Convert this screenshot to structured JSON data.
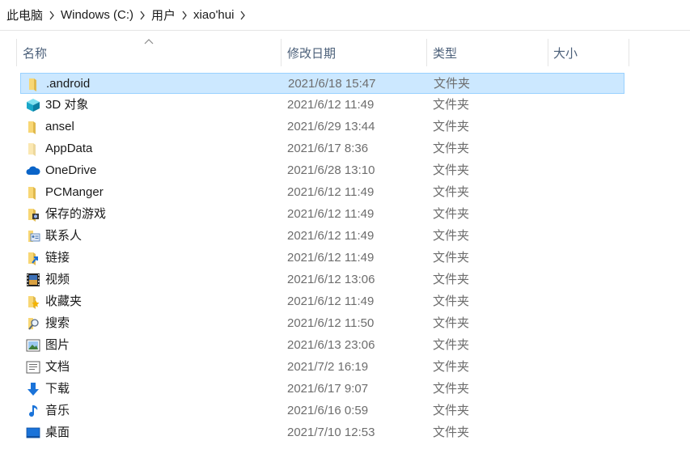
{
  "breadcrumb": [
    "此电脑",
    "Windows (C:)",
    "用户",
    "xiao'hui"
  ],
  "columns": {
    "name": "名称",
    "date": "修改日期",
    "type": "类型",
    "size": "大小"
  },
  "items": [
    {
      "name": ".android",
      "date": "2021/6/18 15:47",
      "type": "文件夹",
      "icon": "folder-icon",
      "selected": true
    },
    {
      "name": "3D 对象",
      "date": "2021/6/12 11:49",
      "type": "文件夹",
      "icon": "3d-objects-icon"
    },
    {
      "name": "ansel",
      "date": "2021/6/29 13:44",
      "type": "文件夹",
      "icon": "folder-icon"
    },
    {
      "name": "AppData",
      "date": "2021/6/17 8:36",
      "type": "文件夹",
      "icon": "folder-hidden-icon"
    },
    {
      "name": "OneDrive",
      "date": "2021/6/28 13:10",
      "type": "文件夹",
      "icon": "onedrive-icon"
    },
    {
      "name": "PCManger",
      "date": "2021/6/12 11:49",
      "type": "文件夹",
      "icon": "folder-icon"
    },
    {
      "name": "保存的游戏",
      "date": "2021/6/12 11:49",
      "type": "文件夹",
      "icon": "saved-games-icon"
    },
    {
      "name": "联系人",
      "date": "2021/6/12 11:49",
      "type": "文件夹",
      "icon": "contacts-icon"
    },
    {
      "name": "链接",
      "date": "2021/6/12 11:49",
      "type": "文件夹",
      "icon": "links-icon"
    },
    {
      "name": "视频",
      "date": "2021/6/12 13:06",
      "type": "文件夹",
      "icon": "videos-icon"
    },
    {
      "name": "收藏夹",
      "date": "2021/6/12 11:49",
      "type": "文件夹",
      "icon": "favorites-icon"
    },
    {
      "name": "搜索",
      "date": "2021/6/12 11:50",
      "type": "文件夹",
      "icon": "searches-icon"
    },
    {
      "name": "图片",
      "date": "2021/6/13 23:06",
      "type": "文件夹",
      "icon": "pictures-icon"
    },
    {
      "name": "文档",
      "date": "2021/7/2 16:19",
      "type": "文件夹",
      "icon": "documents-icon"
    },
    {
      "name": "下载",
      "date": "2021/6/17 9:07",
      "type": "文件夹",
      "icon": "downloads-icon"
    },
    {
      "name": "音乐",
      "date": "2021/6/16 0:59",
      "type": "文件夹",
      "icon": "music-icon"
    },
    {
      "name": "桌面",
      "date": "2021/7/10 12:53",
      "type": "文件夹",
      "icon": "desktop-icon"
    }
  ],
  "colors": {
    "selected_bg": "#cce8ff",
    "selected_border": "#99d1ff",
    "header_text": "#4c607a",
    "folder": "#f8d775"
  }
}
